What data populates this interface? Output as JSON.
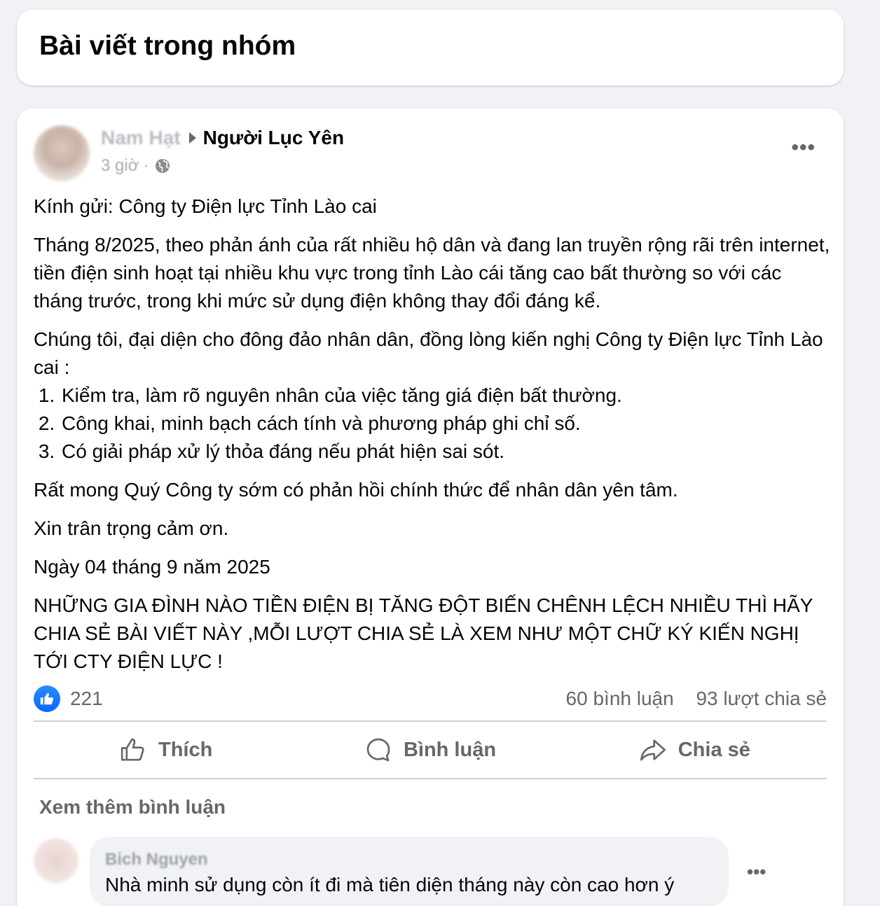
{
  "header": {
    "title": "Bài viết trong nhóm"
  },
  "post": {
    "author": "Nam Hạt",
    "group": "Người Lục Yên",
    "time": "3 giờ",
    "separator": "·",
    "more_label": "•••",
    "paragraphs": [
      "Kính gửi: Công ty Điện lực Tỉnh Lào cai",
      "Tháng 8/2025, theo phản ánh của rất nhiều hộ dân và đang lan truyền rộng rãi trên internet, tiền điện sinh hoạt tại nhiều khu vực trong tỉnh Lào cái tăng cao bất thường so với các tháng trước, trong khi mức sử dụng điện không thay đổi đáng kể.",
      "Chúng tôi, đại diện cho đông đảo nhân dân, đồng lòng kiến nghị Công ty Điện lực Tỉnh Lào cai :"
    ],
    "list": [
      "Kiểm tra, làm rõ nguyên nhân của việc tăng giá điện bất thường.",
      "Công khai, minh bạch cách tính và phương pháp ghi chỉ số.",
      "Có giải pháp xử lý thỏa đáng nếu phát hiện sai sót."
    ],
    "closing": [
      "Rất mong Quý Công ty sớm có phản hồi chính thức để nhân dân yên tâm.",
      "Xin trân trọng cảm ơn.",
      "Ngày 04 tháng 9 năm 2025",
      "NHỮNG GIA ĐÌNH NÀO TIỀN ĐIỆN BỊ TĂNG ĐỘT BIẾN CHÊNH LỆCH NHIỀU THÌ HÃY CHIA SẺ BÀI VIẾT NÀY ,MỖI LƯỢT CHIA SẺ LÀ XEM NHƯ MỘT CHỮ KÝ KIẾN NGHỊ TỚI CTY ĐIỆN LỰC !"
    ],
    "stats": {
      "likes": "221",
      "comments": "60 bình luận",
      "shares": "93 lượt chia sẻ"
    },
    "actions": {
      "like": "Thích",
      "comment": "Bình luận",
      "share": "Chia sẻ"
    },
    "see_more_comments": "Xem thêm bình luận"
  },
  "comment": {
    "author": "Bich Nguyen",
    "text": "Nhà minh sử dụng còn ít đi mà tiên diện tháng này còn cao hơn ý",
    "more_label": "•••"
  },
  "colors": {
    "accent": "#0866ff",
    "secondary_text": "#65676b",
    "page_background": "#f0f2f5"
  }
}
